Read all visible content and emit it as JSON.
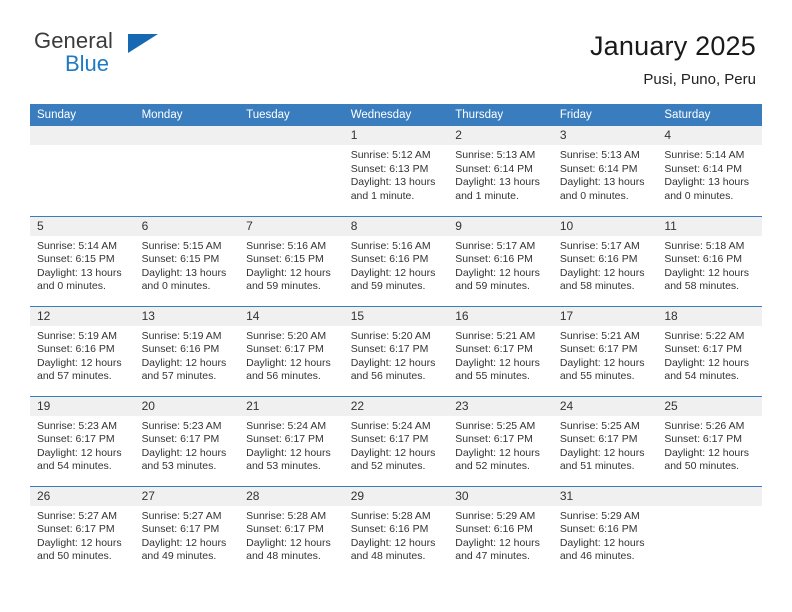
{
  "logo": {
    "word_top": "General",
    "word_bottom": "Blue",
    "triangle_color": "#1668b3",
    "text_color": "#3b3b3b",
    "blue_color": "#1f7ac4"
  },
  "header": {
    "title": "January 2025",
    "subtitle": "Pusi, Puno, Peru"
  },
  "theme": {
    "header_bg": "#3a7dbf",
    "header_text": "#ffffff",
    "daynum_bg": "#f0f0f0",
    "row_divider": "#3a7dbf"
  },
  "weekday_headers": [
    "Sunday",
    "Monday",
    "Tuesday",
    "Wednesday",
    "Thursday",
    "Friday",
    "Saturday"
  ],
  "labels": {
    "sunrise": "Sunrise:",
    "sunset": "Sunset:",
    "daylight": "Daylight:"
  },
  "weeks": [
    [
      {
        "day": "",
        "empty": true
      },
      {
        "day": "",
        "empty": true
      },
      {
        "day": "",
        "empty": true
      },
      {
        "day": "1",
        "sunrise": "Sunrise: 5:12 AM",
        "sunset": "Sunset: 6:13 PM",
        "daylight": "Daylight: 13 hours and 1 minute."
      },
      {
        "day": "2",
        "sunrise": "Sunrise: 5:13 AM",
        "sunset": "Sunset: 6:14 PM",
        "daylight": "Daylight: 13 hours and 1 minute."
      },
      {
        "day": "3",
        "sunrise": "Sunrise: 5:13 AM",
        "sunset": "Sunset: 6:14 PM",
        "daylight": "Daylight: 13 hours and 0 minutes."
      },
      {
        "day": "4",
        "sunrise": "Sunrise: 5:14 AM",
        "sunset": "Sunset: 6:14 PM",
        "daylight": "Daylight: 13 hours and 0 minutes."
      }
    ],
    [
      {
        "day": "5",
        "sunrise": "Sunrise: 5:14 AM",
        "sunset": "Sunset: 6:15 PM",
        "daylight": "Daylight: 13 hours and 0 minutes."
      },
      {
        "day": "6",
        "sunrise": "Sunrise: 5:15 AM",
        "sunset": "Sunset: 6:15 PM",
        "daylight": "Daylight: 13 hours and 0 minutes."
      },
      {
        "day": "7",
        "sunrise": "Sunrise: 5:16 AM",
        "sunset": "Sunset: 6:15 PM",
        "daylight": "Daylight: 12 hours and 59 minutes."
      },
      {
        "day": "8",
        "sunrise": "Sunrise: 5:16 AM",
        "sunset": "Sunset: 6:16 PM",
        "daylight": "Daylight: 12 hours and 59 minutes."
      },
      {
        "day": "9",
        "sunrise": "Sunrise: 5:17 AM",
        "sunset": "Sunset: 6:16 PM",
        "daylight": "Daylight: 12 hours and 59 minutes."
      },
      {
        "day": "10",
        "sunrise": "Sunrise: 5:17 AM",
        "sunset": "Sunset: 6:16 PM",
        "daylight": "Daylight: 12 hours and 58 minutes."
      },
      {
        "day": "11",
        "sunrise": "Sunrise: 5:18 AM",
        "sunset": "Sunset: 6:16 PM",
        "daylight": "Daylight: 12 hours and 58 minutes."
      }
    ],
    [
      {
        "day": "12",
        "sunrise": "Sunrise: 5:19 AM",
        "sunset": "Sunset: 6:16 PM",
        "daylight": "Daylight: 12 hours and 57 minutes."
      },
      {
        "day": "13",
        "sunrise": "Sunrise: 5:19 AM",
        "sunset": "Sunset: 6:16 PM",
        "daylight": "Daylight: 12 hours and 57 minutes."
      },
      {
        "day": "14",
        "sunrise": "Sunrise: 5:20 AM",
        "sunset": "Sunset: 6:17 PM",
        "daylight": "Daylight: 12 hours and 56 minutes."
      },
      {
        "day": "15",
        "sunrise": "Sunrise: 5:20 AM",
        "sunset": "Sunset: 6:17 PM",
        "daylight": "Daylight: 12 hours and 56 minutes."
      },
      {
        "day": "16",
        "sunrise": "Sunrise: 5:21 AM",
        "sunset": "Sunset: 6:17 PM",
        "daylight": "Daylight: 12 hours and 55 minutes."
      },
      {
        "day": "17",
        "sunrise": "Sunrise: 5:21 AM",
        "sunset": "Sunset: 6:17 PM",
        "daylight": "Daylight: 12 hours and 55 minutes."
      },
      {
        "day": "18",
        "sunrise": "Sunrise: 5:22 AM",
        "sunset": "Sunset: 6:17 PM",
        "daylight": "Daylight: 12 hours and 54 minutes."
      }
    ],
    [
      {
        "day": "19",
        "sunrise": "Sunrise: 5:23 AM",
        "sunset": "Sunset: 6:17 PM",
        "daylight": "Daylight: 12 hours and 54 minutes."
      },
      {
        "day": "20",
        "sunrise": "Sunrise: 5:23 AM",
        "sunset": "Sunset: 6:17 PM",
        "daylight": "Daylight: 12 hours and 53 minutes."
      },
      {
        "day": "21",
        "sunrise": "Sunrise: 5:24 AM",
        "sunset": "Sunset: 6:17 PM",
        "daylight": "Daylight: 12 hours and 53 minutes."
      },
      {
        "day": "22",
        "sunrise": "Sunrise: 5:24 AM",
        "sunset": "Sunset: 6:17 PM",
        "daylight": "Daylight: 12 hours and 52 minutes."
      },
      {
        "day": "23",
        "sunrise": "Sunrise: 5:25 AM",
        "sunset": "Sunset: 6:17 PM",
        "daylight": "Daylight: 12 hours and 52 minutes."
      },
      {
        "day": "24",
        "sunrise": "Sunrise: 5:25 AM",
        "sunset": "Sunset: 6:17 PM",
        "daylight": "Daylight: 12 hours and 51 minutes."
      },
      {
        "day": "25",
        "sunrise": "Sunrise: 5:26 AM",
        "sunset": "Sunset: 6:17 PM",
        "daylight": "Daylight: 12 hours and 50 minutes."
      }
    ],
    [
      {
        "day": "26",
        "sunrise": "Sunrise: 5:27 AM",
        "sunset": "Sunset: 6:17 PM",
        "daylight": "Daylight: 12 hours and 50 minutes."
      },
      {
        "day": "27",
        "sunrise": "Sunrise: 5:27 AM",
        "sunset": "Sunset: 6:17 PM",
        "daylight": "Daylight: 12 hours and 49 minutes."
      },
      {
        "day": "28",
        "sunrise": "Sunrise: 5:28 AM",
        "sunset": "Sunset: 6:17 PM",
        "daylight": "Daylight: 12 hours and 48 minutes."
      },
      {
        "day": "29",
        "sunrise": "Sunrise: 5:28 AM",
        "sunset": "Sunset: 6:16 PM",
        "daylight": "Daylight: 12 hours and 48 minutes."
      },
      {
        "day": "30",
        "sunrise": "Sunrise: 5:29 AM",
        "sunset": "Sunset: 6:16 PM",
        "daylight": "Daylight: 12 hours and 47 minutes."
      },
      {
        "day": "31",
        "sunrise": "Sunrise: 5:29 AM",
        "sunset": "Sunset: 6:16 PM",
        "daylight": "Daylight: 12 hours and 46 minutes."
      },
      {
        "day": "",
        "empty": true
      }
    ]
  ]
}
